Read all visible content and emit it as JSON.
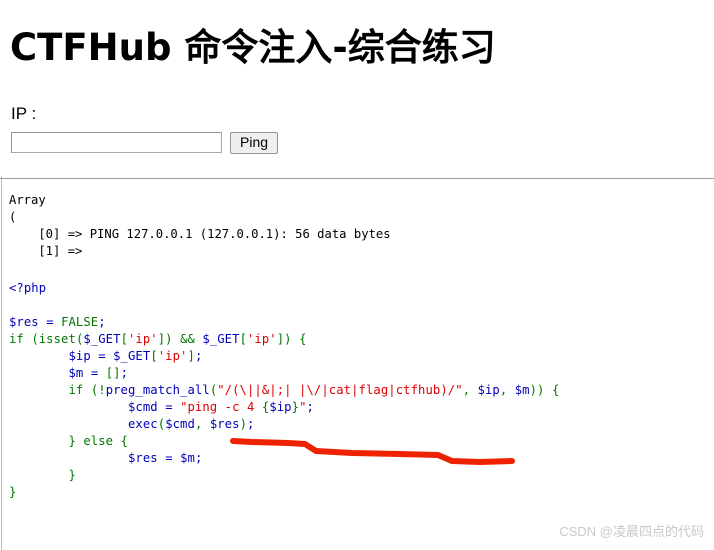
{
  "header": {
    "title": "CTFHub 命令注入-综合练习"
  },
  "form": {
    "ip_label": "IP :",
    "ip_value": "",
    "ip_placeholder": "",
    "ping_label": "Ping"
  },
  "output": {
    "array_dump": "Array\n(\n    [0] => PING 127.0.0.1 (127.0.0.1): 56 data bytes\n    [1] =>"
  },
  "source": {
    "open_tag": "<?php",
    "lines": [
      "$res = FALSE;",
      "if (isset($_GET['ip']) && $_GET['ip']) {",
      "    $ip = $_GET['ip'];",
      "    $m = [];",
      "    if (!preg_match_all(\"/(\\||&|;| |\\/|cat|flag|ctfhub)/\", $ip, $m)) {",
      "        $cmd = \"ping -c 4 {$ip}\";",
      "        exec($cmd, $res);",
      "    } else {",
      "        $res = $m;",
      "    }",
      "}"
    ],
    "regex_filter": "/(\\||&|;| |\\/|cat|flag|ctfhub)/",
    "blocked_tokens": [
      "|",
      "&",
      ";",
      " ",
      "/",
      "cat",
      "flag",
      "ctfhub"
    ],
    "command_template": "ping -c 4 {$ip}"
  },
  "annotation": {
    "color": "#ee2200",
    "kind": "hand-drawn-underline",
    "target": "regex-filter-line"
  },
  "watermark": {
    "text": "CSDN @凌晨四点的代码",
    "color": "#c8c8c8"
  }
}
